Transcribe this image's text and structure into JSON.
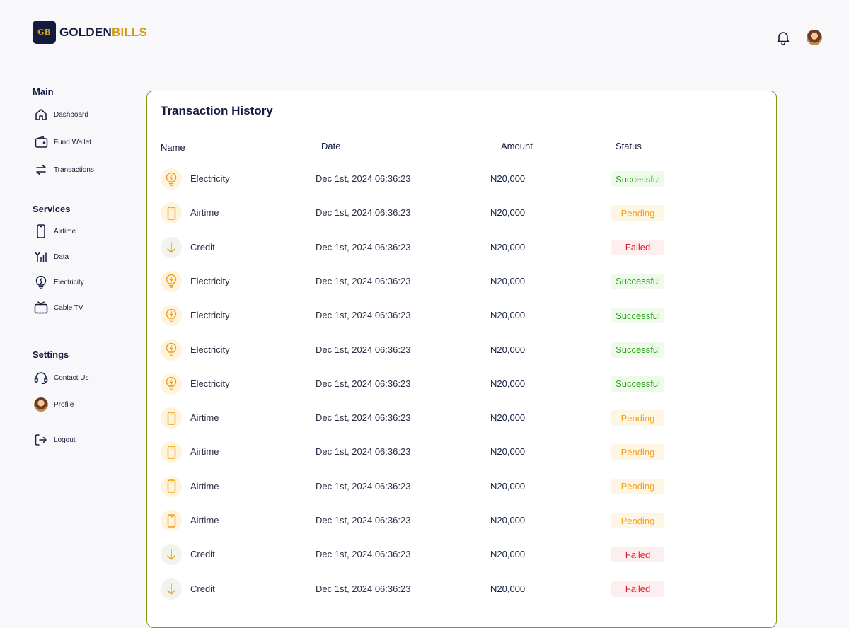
{
  "brand": {
    "mark": "GB",
    "name_part1": "GOLDEN",
    "name_part2": "BILLS"
  },
  "colors": {
    "gold": "#d49a17",
    "navy": "#141b3e",
    "card_border": "#7d9a11"
  },
  "header": {
    "icons": [
      "bell-icon",
      "user-avatar"
    ]
  },
  "sidebar": {
    "sections": [
      {
        "title": "Main",
        "items": [
          {
            "label": "Dashboard",
            "icon": "home-icon"
          },
          {
            "label": "Fund Wallet",
            "icon": "wallet-icon"
          },
          {
            "label": "Transactions",
            "icon": "transfer-arrows-icon"
          }
        ]
      },
      {
        "title": "Services",
        "items": [
          {
            "label": "Airtime",
            "icon": "phone-icon"
          },
          {
            "label": "Data",
            "icon": "signal-icon"
          },
          {
            "label": "Electricity",
            "icon": "bulb-icon"
          },
          {
            "label": "Cable TV",
            "icon": "tv-icon"
          }
        ]
      },
      {
        "title": "Settings",
        "items": [
          {
            "label": "Contact Us",
            "icon": "headset-icon"
          },
          {
            "label": "Profile",
            "icon": "avatar"
          },
          {
            "label": "Logout",
            "icon": "logout-icon"
          }
        ]
      }
    ]
  },
  "transactions": {
    "title": "Transaction History",
    "columns": {
      "name": "Name",
      "date": "Date",
      "amount": "Amount",
      "status": "Status"
    },
    "rows": [
      {
        "name": "Electricity",
        "type": "electricity",
        "date": "Dec 1st, 2024 06:36:23",
        "amount": "N20,000",
        "status": "Successful"
      },
      {
        "name": "Airtime",
        "type": "airtime",
        "date": "Dec 1st, 2024 06:36:23",
        "amount": "N20,000",
        "status": "Pending"
      },
      {
        "name": "Credit",
        "type": "credit",
        "date": "Dec 1st, 2024 06:36:23",
        "amount": "N20,000",
        "status": "Failed"
      },
      {
        "name": "Electricity",
        "type": "electricity",
        "date": "Dec 1st, 2024 06:36:23",
        "amount": "N20,000",
        "status": "Successful"
      },
      {
        "name": "Electricity",
        "type": "electricity",
        "date": "Dec 1st, 2024 06:36:23",
        "amount": "N20,000",
        "status": "Successful"
      },
      {
        "name": "Electricity",
        "type": "electricity",
        "date": "Dec 1st, 2024 06:36:23",
        "amount": "N20,000",
        "status": "Successful"
      },
      {
        "name": "Electricity",
        "type": "electricity",
        "date": "Dec 1st, 2024 06:36:23",
        "amount": "N20,000",
        "status": "Successful"
      },
      {
        "name": "Airtime",
        "type": "airtime",
        "date": "Dec 1st, 2024 06:36:23",
        "amount": "N20,000",
        "status": "Pending"
      },
      {
        "name": "Airtime",
        "type": "airtime",
        "date": "Dec 1st, 2024 06:36:23",
        "amount": "N20,000",
        "status": "Pending"
      },
      {
        "name": "Airtime",
        "type": "airtime",
        "date": "Dec 1st, 2024 06:36:23",
        "amount": "N20,000",
        "status": "Pending"
      },
      {
        "name": "Airtime",
        "type": "airtime",
        "date": "Dec 1st, 2024 06:36:23",
        "amount": "N20,000",
        "status": "Pending"
      },
      {
        "name": "Credit",
        "type": "credit",
        "date": "Dec 1st, 2024 06:36:23",
        "amount": "N20,000",
        "status": "Failed"
      },
      {
        "name": "Credit",
        "type": "credit",
        "date": "Dec 1st, 2024 06:36:23",
        "amount": "N20,000",
        "status": "Failed"
      }
    ]
  }
}
